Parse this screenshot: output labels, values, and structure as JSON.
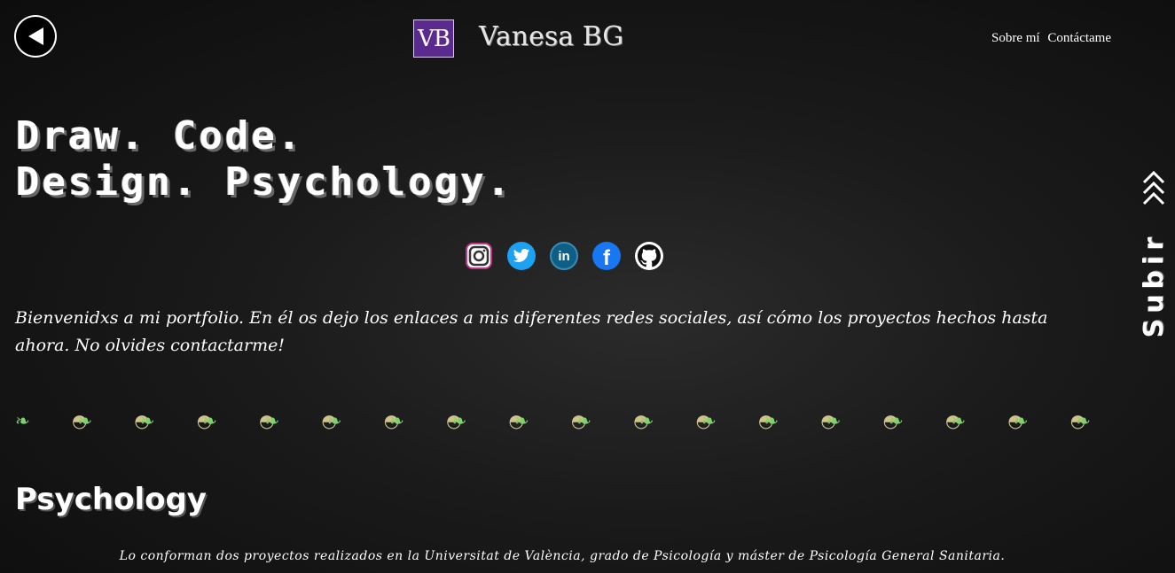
{
  "header": {
    "logo_text": "VB",
    "site_name": "Vanesa BG",
    "nav": [
      {
        "label": "Sobre mí"
      },
      {
        "label": "Contáctame"
      }
    ]
  },
  "hero": {
    "line1": "Draw. Code.",
    "line2": "Design. Psychology."
  },
  "socials": [
    {
      "name": "instagram-icon",
      "color": "#c13584"
    },
    {
      "name": "twitter-icon",
      "color": "#1da1f2"
    },
    {
      "name": "linkedin-icon",
      "color": "#0a66c2"
    },
    {
      "name": "facebook-icon",
      "color": "#1877f2"
    },
    {
      "name": "github-icon",
      "color": "#ffffff"
    }
  ],
  "welcome": "Bienvenidxs a mi portfolio. En él os dejo los enlaces a mis diferentes redes sociales, así cómo los proyectos hechos hasta ahora. No olvides contactarme!",
  "psychology": {
    "title": "Psychology",
    "description": "Lo conforman dos proyectos realizados en la Universitat de València, grado de Psicología y máster de Psicología General Sanitaria."
  },
  "scroll_top": {
    "label": "Subir"
  }
}
